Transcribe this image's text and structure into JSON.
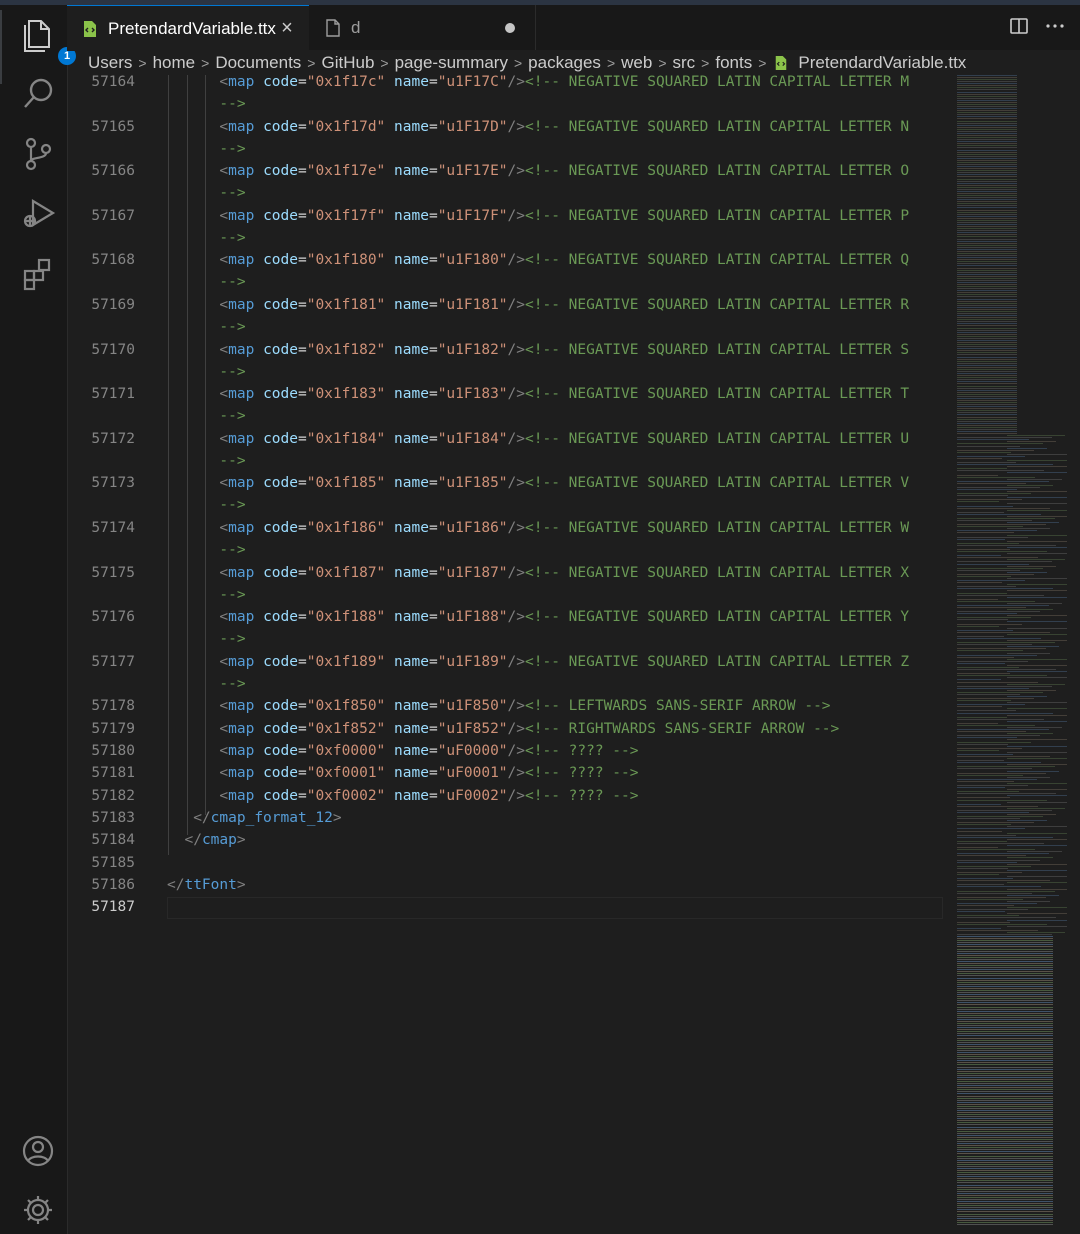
{
  "activity": {
    "explorer_badge": "1",
    "icons": [
      "files-icon",
      "search-icon",
      "source-control-icon",
      "run-debug-icon",
      "extensions-icon",
      "account-icon",
      "settings-gear-icon"
    ]
  },
  "tabs": [
    {
      "label": "PretendardVariable.ttx",
      "active": true
    },
    {
      "label": "d",
      "active": false,
      "modified": true
    }
  ],
  "breadcrumb": [
    "Users",
    "home",
    "Documents",
    "GitHub",
    "page-summary",
    "packages",
    "web",
    "src",
    "fonts",
    "PretendardVariable.ttx"
  ],
  "editor": {
    "current_line": "57187",
    "lines": [
      {
        "n": "57164",
        "indent": "    ",
        "code": "0x1f17c",
        "name": "u1F17C",
        "comment": "NEGATIVE SQUARED LATIN CAPITAL LETTER M",
        "wrapped": true
      },
      {
        "n": "57165",
        "indent": "    ",
        "code": "0x1f17d",
        "name": "u1F17D",
        "comment": "NEGATIVE SQUARED LATIN CAPITAL LETTER N",
        "wrapped": true
      },
      {
        "n": "57166",
        "indent": "    ",
        "code": "0x1f17e",
        "name": "u1F17E",
        "comment": "NEGATIVE SQUARED LATIN CAPITAL LETTER O",
        "wrapped": true
      },
      {
        "n": "57167",
        "indent": "    ",
        "code": "0x1f17f",
        "name": "u1F17F",
        "comment": "NEGATIVE SQUARED LATIN CAPITAL LETTER P",
        "wrapped": true
      },
      {
        "n": "57168",
        "indent": "    ",
        "code": "0x1f180",
        "name": "u1F180",
        "comment": "NEGATIVE SQUARED LATIN CAPITAL LETTER Q",
        "wrapped": true
      },
      {
        "n": "57169",
        "indent": "    ",
        "code": "0x1f181",
        "name": "u1F181",
        "comment": "NEGATIVE SQUARED LATIN CAPITAL LETTER R",
        "wrapped": true
      },
      {
        "n": "57170",
        "indent": "    ",
        "code": "0x1f182",
        "name": "u1F182",
        "comment": "NEGATIVE SQUARED LATIN CAPITAL LETTER S",
        "wrapped": true
      },
      {
        "n": "57171",
        "indent": "    ",
        "code": "0x1f183",
        "name": "u1F183",
        "comment": "NEGATIVE SQUARED LATIN CAPITAL LETTER T",
        "wrapped": true
      },
      {
        "n": "57172",
        "indent": "    ",
        "code": "0x1f184",
        "name": "u1F184",
        "comment": "NEGATIVE SQUARED LATIN CAPITAL LETTER U",
        "wrapped": true
      },
      {
        "n": "57173",
        "indent": "    ",
        "code": "0x1f185",
        "name": "u1F185",
        "comment": "NEGATIVE SQUARED LATIN CAPITAL LETTER V",
        "wrapped": true
      },
      {
        "n": "57174",
        "indent": "    ",
        "code": "0x1f186",
        "name": "u1F186",
        "comment": "NEGATIVE SQUARED LATIN CAPITAL LETTER W",
        "wrapped": true
      },
      {
        "n": "57175",
        "indent": "    ",
        "code": "0x1f187",
        "name": "u1F187",
        "comment": "NEGATIVE SQUARED LATIN CAPITAL LETTER X",
        "wrapped": true
      },
      {
        "n": "57176",
        "indent": "    ",
        "code": "0x1f188",
        "name": "u1F188",
        "comment": "NEGATIVE SQUARED LATIN CAPITAL LETTER Y",
        "wrapped": true
      },
      {
        "n": "57177",
        "indent": "    ",
        "code": "0x1f189",
        "name": "u1F189",
        "comment": "NEGATIVE SQUARED LATIN CAPITAL LETTER Z",
        "wrapped": true
      },
      {
        "n": "57178",
        "indent": "    ",
        "code": "0x1f850",
        "name": "u1F850",
        "comment": "LEFTWARDS SANS-SERIF ARROW",
        "wrapped": false
      },
      {
        "n": "57179",
        "indent": "    ",
        "code": "0x1f852",
        "name": "u1F852",
        "comment": "RIGHTWARDS SANS-SERIF ARROW",
        "wrapped": false
      },
      {
        "n": "57180",
        "indent": "    ",
        "code": "0xf0000",
        "name": "uF0000",
        "comment": "????",
        "wrapped": false
      },
      {
        "n": "57181",
        "indent": "    ",
        "code": "0xf0001",
        "name": "uF0001",
        "comment": "????",
        "wrapped": false
      },
      {
        "n": "57182",
        "indent": "    ",
        "code": "0xf0002",
        "name": "uF0002",
        "comment": "????",
        "wrapped": false
      }
    ],
    "closing": [
      {
        "n": "57183",
        "indent": "   ",
        "tag": "cmap_format_12"
      },
      {
        "n": "57184",
        "indent": "  ",
        "tag": "cmap"
      },
      {
        "n": "57185",
        "indent": "",
        "tag": ""
      },
      {
        "n": "57186",
        "indent": "",
        "tag": "ttFont"
      },
      {
        "n": "57187",
        "indent": "",
        "tag": ""
      }
    ],
    "wrap_continuation": "-->"
  },
  "colors": {
    "background": "#1e1e1e",
    "tag": "#569cd6",
    "attribute": "#9cdcfe",
    "string": "#ce9178",
    "comment": "#6a9955",
    "accent": "#0078d4"
  }
}
